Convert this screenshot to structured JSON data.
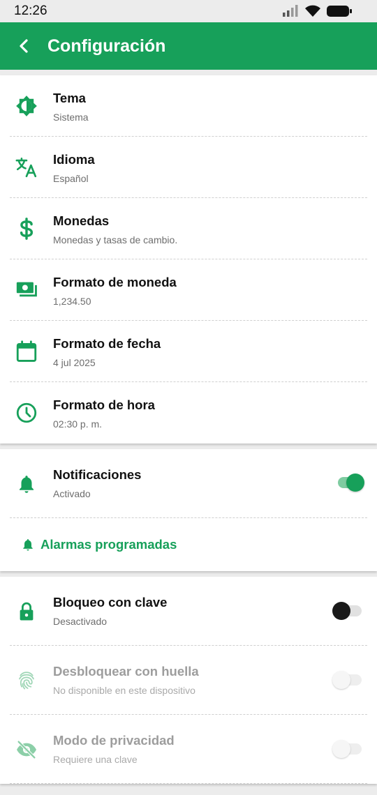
{
  "status_bar": {
    "time": "12:26"
  },
  "app_bar": {
    "title": "Configuración"
  },
  "general": [
    {
      "icon": "theme-icon",
      "title": "Tema",
      "subtitle": "Sistema"
    },
    {
      "icon": "translate-icon",
      "title": "Idioma",
      "subtitle": "Español"
    },
    {
      "icon": "dollar-icon",
      "title": "Monedas",
      "subtitle": "Monedas y tasas de cambio."
    },
    {
      "icon": "cash-icon",
      "title": "Formato de moneda",
      "subtitle": "1,234.50"
    },
    {
      "icon": "calendar-icon",
      "title": "Formato de fecha",
      "subtitle": "4 jul 2025"
    },
    {
      "icon": "clock-icon",
      "title": "Formato de hora",
      "subtitle": "02:30 p. m."
    }
  ],
  "notifications": {
    "title": "Notificaciones",
    "subtitle": "Activado",
    "enabled": true,
    "alarms_label": "Alarmas programadas"
  },
  "security": [
    {
      "icon": "lock-icon",
      "title": "Bloqueo con clave",
      "subtitle": "Desactivado",
      "enabled": false,
      "disabled": false
    },
    {
      "icon": "fingerprint-icon",
      "title": "Desbloquear con huella",
      "subtitle": "No disponible en este dispositivo",
      "enabled": false,
      "disabled": true
    },
    {
      "icon": "eye-off-icon",
      "title": "Modo de privacidad",
      "subtitle": "Requiere una clave",
      "enabled": false,
      "disabled": true
    }
  ],
  "colors": {
    "primary": "#17a05a",
    "background": "#ececec"
  }
}
